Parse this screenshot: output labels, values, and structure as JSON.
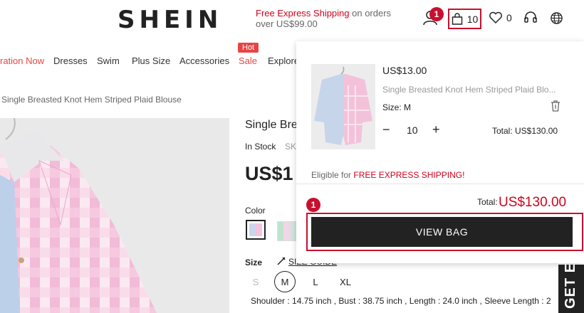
{
  "header": {
    "logo": "SHEIN",
    "promo_highlight": "Free Express Shipping",
    "promo_rest": " on orders over US$99.00",
    "user_badge": "1",
    "bag_count": "10",
    "wishlist_count": "0"
  },
  "nav": {
    "items": [
      "ration Now",
      "Dresses",
      "Swim",
      "Plus Size",
      "Accessories",
      "Sale",
      "Explore"
    ],
    "hot_tag": "Hot"
  },
  "breadcrumb": "Single Breasted Knot Hem Striped Plaid Blouse",
  "product": {
    "title": "Single Bre",
    "stock": "In Stock",
    "sku": "SK",
    "price": "US$1",
    "color_label": "Color",
    "size_label": "Size",
    "size_guide": "SIZE GUIDE",
    "sizes": [
      "S",
      "M",
      "L",
      "XL"
    ],
    "measurements": "Shoulder : 14.75 inch ,  Bust : 38.75 inch ,  Length : 24.0 inch ,  Sleeve Length : 2"
  },
  "side_tab": "GET EX",
  "cart": {
    "item_price": "US$13.00",
    "item_name": "Single Breasted Knot Hem Striped Plaid Blo...",
    "item_size": "Size: M",
    "minus": "−",
    "qty": "10",
    "plus": "+",
    "item_total": "Total: US$130.00",
    "eligible_prefix": "Eligible for ",
    "eligible_highlight": "FREE EXPRESS SHIPPING!",
    "total_label": "Total:",
    "total_value": "US$130.00",
    "view_bag_badge": "1",
    "view_bag": "VIEW BAG"
  },
  "colors": {
    "brand_red": "#c8102e",
    "sale_red": "#e64545",
    "button_dark": "#222222"
  }
}
